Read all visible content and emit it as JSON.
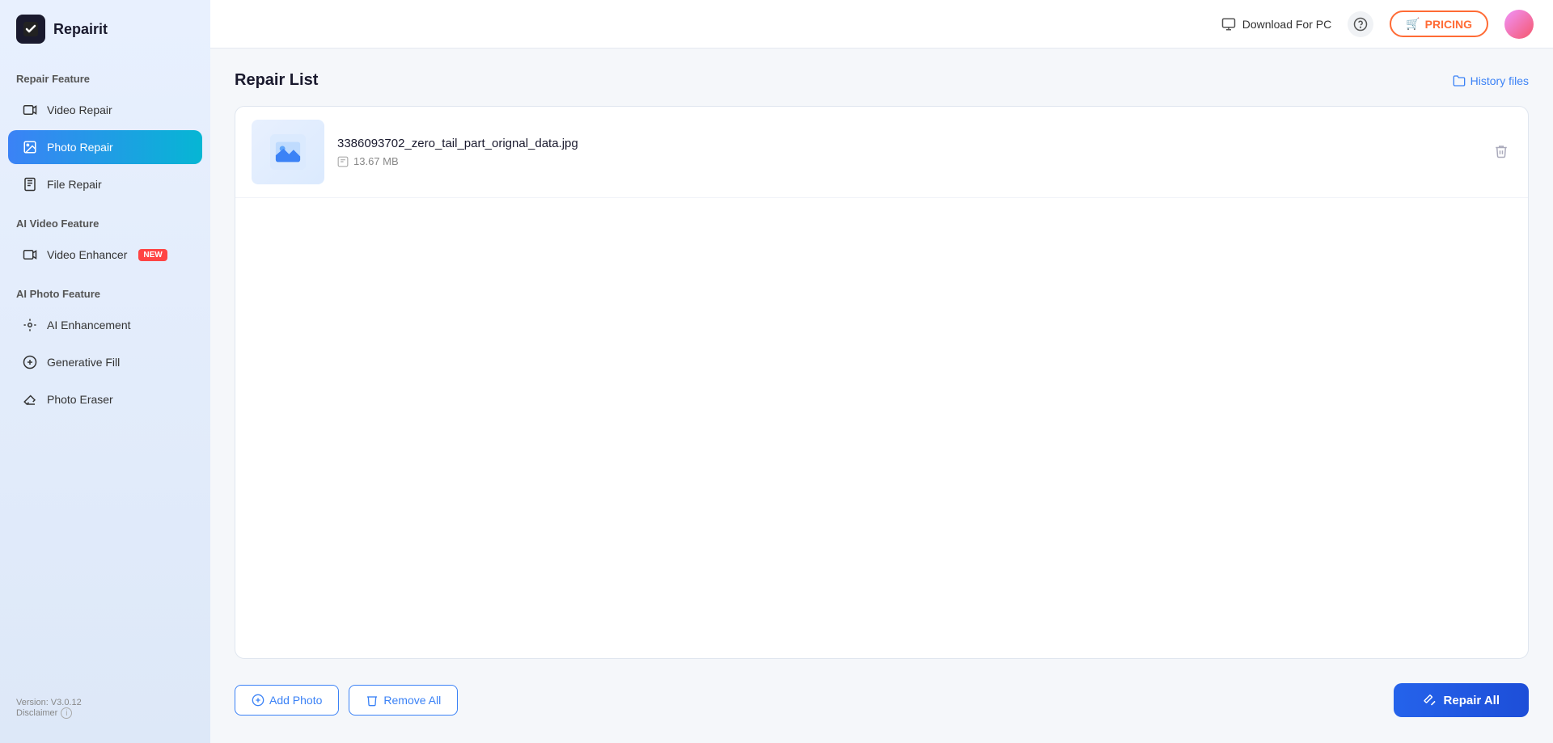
{
  "app": {
    "name": "Repairit"
  },
  "sidebar": {
    "repair_feature_label": "Repair Feature",
    "ai_video_feature_label": "AI Video Feature",
    "ai_photo_feature_label": "AI Photo Feature",
    "items": [
      {
        "id": "video-repair",
        "label": "Video Repair",
        "active": false
      },
      {
        "id": "photo-repair",
        "label": "Photo Repair",
        "active": true
      },
      {
        "id": "file-repair",
        "label": "File Repair",
        "active": false
      }
    ],
    "ai_video_items": [
      {
        "id": "video-enhancer",
        "label": "Video Enhancer",
        "badge": "NEW"
      }
    ],
    "ai_photo_items": [
      {
        "id": "ai-enhancement",
        "label": "AI Enhancement"
      },
      {
        "id": "generative-fill",
        "label": "Generative Fill"
      },
      {
        "id": "photo-eraser",
        "label": "Photo Eraser"
      }
    ],
    "version": "Version: V3.0.12",
    "disclaimer": "Disclaimer"
  },
  "header": {
    "download_label": "Download For PC",
    "pricing_label": "PRICING",
    "pricing_icon": "🛒"
  },
  "main": {
    "title": "Repair List",
    "history_label": "History files",
    "files": [
      {
        "name": "3386093702_zero_tail_part_orignal_data.jpg",
        "size": "13.67 MB"
      }
    ],
    "add_photo_label": "Add Photo",
    "remove_all_label": "Remove All",
    "repair_all_label": "Repair All"
  }
}
